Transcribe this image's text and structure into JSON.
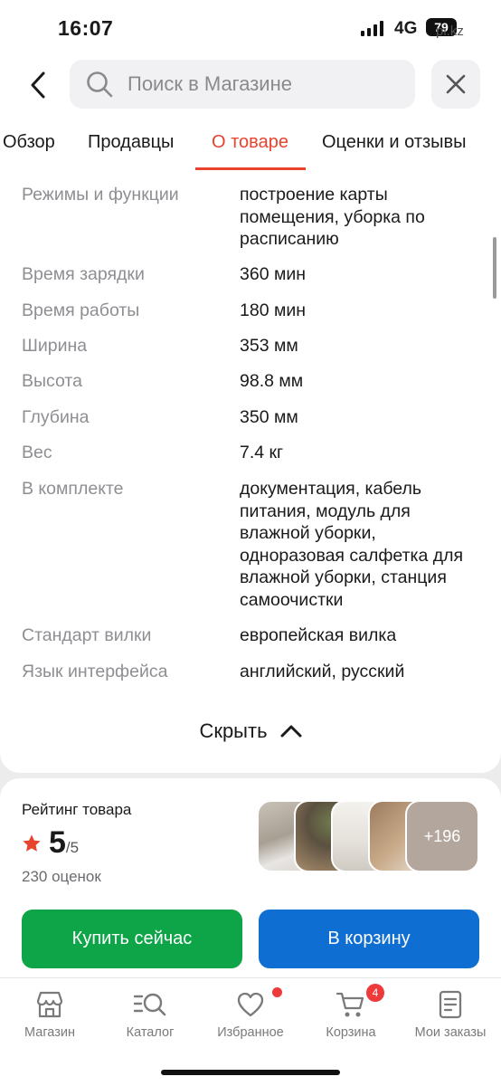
{
  "status": {
    "time": "16:07",
    "network": "4G",
    "battery": "79",
    "watermark": "pi.kz"
  },
  "search": {
    "placeholder": "Поиск в Магазине",
    "icon": "search-icon"
  },
  "tabs": [
    {
      "label": "Обзор",
      "active": false
    },
    {
      "label": "Продавцы",
      "active": false
    },
    {
      "label": "О товаре",
      "active": true
    },
    {
      "label": "Оценки и отзывы",
      "active": false
    }
  ],
  "specs": [
    {
      "key": "Режимы и функции",
      "value": "построение карты помещения, уборка по расписанию"
    },
    {
      "key": "Время зарядки",
      "value": "360 мин"
    },
    {
      "key": "Время работы",
      "value": "180 мин"
    },
    {
      "key": "Ширина",
      "value": "353 мм"
    },
    {
      "key": "Высота",
      "value": "98.8 мм"
    },
    {
      "key": "Глубина",
      "value": "350 мм"
    },
    {
      "key": "Вес",
      "value": "7.4 кг"
    },
    {
      "key": "В комплекте",
      "value": "документация, кабель питания, модуль для влажной уборки, одноразовая салфетка для влажной уборки, станция самоочистки"
    },
    {
      "key": "Стандарт вилки",
      "value": "европейская вилка"
    },
    {
      "key": "Язык интерфейса",
      "value": "английский, русский"
    }
  ],
  "hide_label": "Скрыть",
  "rating": {
    "title": "Рейтинг товара",
    "score": "5",
    "out_of": "/5",
    "count": "230 оценок",
    "more_photos": "+196"
  },
  "actions": {
    "buy_now": "Купить сейчас",
    "add_to_cart": "В корзину"
  },
  "nav": [
    {
      "label": "Магазин",
      "icon": "store-icon"
    },
    {
      "label": "Каталог",
      "icon": "catalog-search-icon"
    },
    {
      "label": "Избранное",
      "icon": "heart-icon"
    },
    {
      "label": "Корзина",
      "icon": "cart-icon",
      "badge": "4"
    },
    {
      "label": "Мои заказы",
      "icon": "orders-icon"
    }
  ],
  "colors": {
    "accent": "#e8432d",
    "buy": "#0ea548",
    "cart": "#0f6ed1",
    "star": "#e8432d"
  }
}
